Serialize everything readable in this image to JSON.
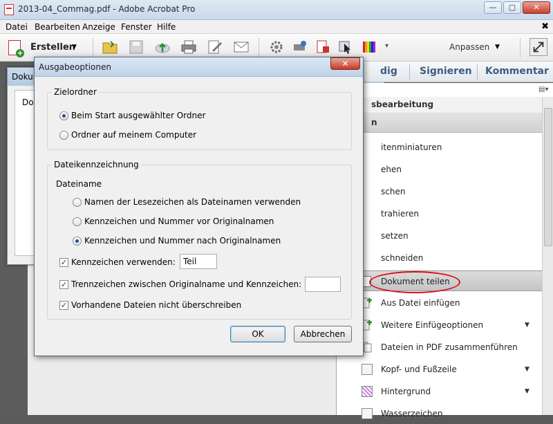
{
  "window": {
    "title": "2013-04_Commag.pdf - Adobe Acrobat Pro"
  },
  "menubar": {
    "items": [
      "Datei",
      "Bearbeiten",
      "Anzeige",
      "Fenster",
      "Hilfe"
    ],
    "close_glyph": "✖"
  },
  "toolbar": {
    "create_label": "Erstellen",
    "customize_label": "Anpassen"
  },
  "tabs": {
    "items": [
      "dig",
      "Signieren",
      "Kommentar"
    ]
  },
  "panel": {
    "section_title": "sbearbeitung",
    "sub_title": "n",
    "items": [
      {
        "label": "itenminiaturen",
        "dropdown": false
      },
      {
        "label": "ehen",
        "dropdown": false
      },
      {
        "label": "schen",
        "dropdown": false
      },
      {
        "label": "trahieren",
        "dropdown": false
      },
      {
        "label": "setzen",
        "dropdown": false
      },
      {
        "label": "schneiden",
        "dropdown": false
      },
      {
        "label": "Dokument teilen",
        "dropdown": false,
        "selected": true
      },
      {
        "label": "Aus Datei einfügen",
        "dropdown": false
      },
      {
        "label": "Weitere Einfügeoptionen",
        "dropdown": true
      },
      {
        "label": "Dateien in PDF zusammenführen",
        "dropdown": false
      },
      {
        "label": "Kopf- und Fußzeile",
        "dropdown": true
      },
      {
        "label": "Hintergrund",
        "dropdown": true
      },
      {
        "label": "Wasserzeichen",
        "dropdown": true
      }
    ]
  },
  "underlying_dialog": {
    "title": "Dokum",
    "text": "Do"
  },
  "dialog": {
    "title": "Ausgabeoptionen",
    "zielordner": {
      "legend": "Zielordner",
      "options": [
        {
          "label": "Beim Start ausgewählter Ordner",
          "selected": true
        },
        {
          "label": "Ordner auf meinem Computer",
          "selected": false
        }
      ]
    },
    "dateikennzeichnung": {
      "legend": "Dateikennzeichnung",
      "dateiname_label": "Dateiname",
      "options": [
        {
          "label": "Namen der Lesezeichen als Dateinamen verwenden",
          "selected": false
        },
        {
          "label": "Kennzeichen und Nummer vor Originalnamen",
          "selected": false
        },
        {
          "label": "Kennzeichen und Nummer nach Originalnamen",
          "selected": true
        }
      ],
      "use_label": {
        "label": "Kennzeichen verwenden:",
        "checked": true,
        "value": "Teil"
      },
      "separator": {
        "label": "Trennzeichen zwischen Originalname und Kennzeichen:",
        "checked": true,
        "value": ""
      },
      "no_overwrite": {
        "label": "Vorhandene Dateien nicht überschreiben",
        "checked": true
      }
    },
    "ok_label": "OK",
    "cancel_label": "Abbrechen"
  },
  "colors": {
    "highlight_circle": "#d8121c",
    "tab_text": "#3b5c7f"
  }
}
